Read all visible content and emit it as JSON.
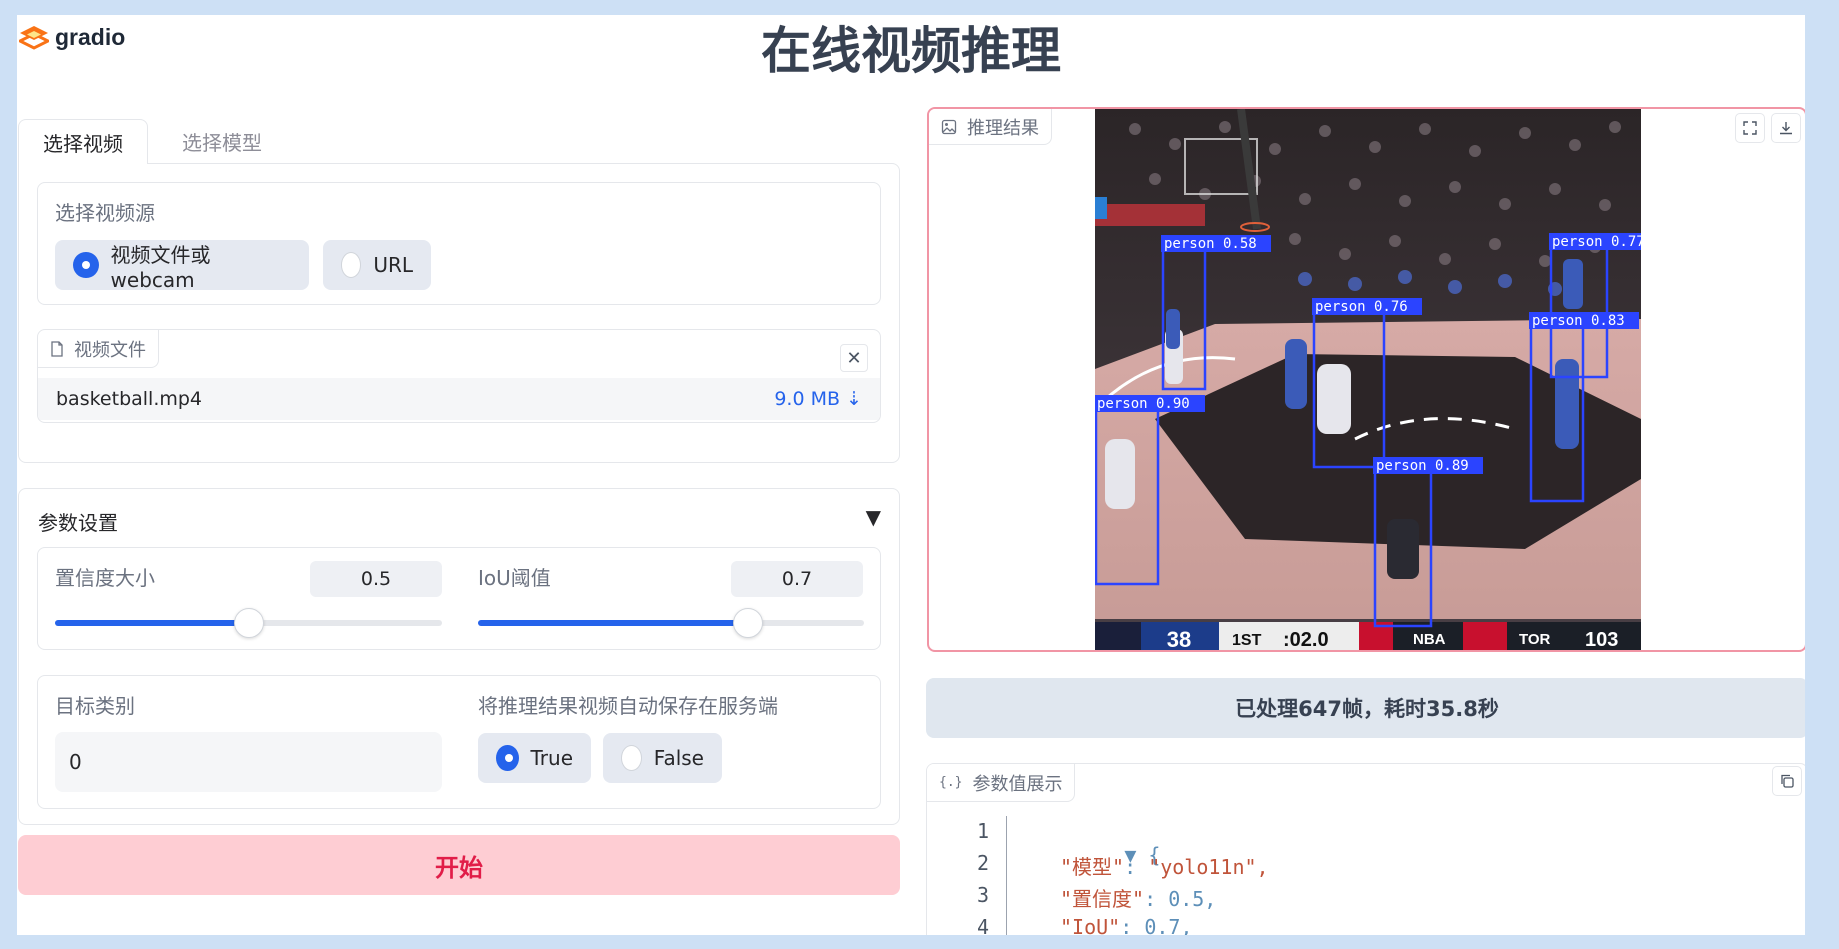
{
  "app": {
    "brand": "gradio",
    "title": "在线视频推理"
  },
  "tabs": [
    {
      "label": "选择视频",
      "active": true
    },
    {
      "label": "选择模型",
      "active": false
    }
  ],
  "video_source": {
    "label": "选择视频源",
    "options": [
      {
        "label": "视频文件或webcam",
        "selected": true
      },
      {
        "label": "URL",
        "selected": false
      }
    ]
  },
  "video_file": {
    "label": "视频文件",
    "file_name": "basketball.mp4",
    "file_size": "9.0 MB ⇣"
  },
  "params": {
    "title": "参数设置",
    "arrow": "▼",
    "confidence": {
      "label": "置信度大小",
      "value": "0.5",
      "fraction": 0.5
    },
    "iou": {
      "label": "IoU阈值",
      "value": "0.7",
      "fraction": 0.7
    },
    "target_class": {
      "label": "目标类别",
      "value": "0"
    },
    "auto_save": {
      "label": "将推理结果视频自动保存在服务端",
      "options": [
        {
          "label": "True",
          "selected": true
        },
        {
          "label": "False",
          "selected": false
        }
      ]
    }
  },
  "start_label": "开始",
  "result": {
    "label": "推理结果",
    "detections": [
      "person 0.58",
      "person 0.77",
      "person 0.76",
      "person 0.83",
      "person 0.90",
      "person 0.89"
    ],
    "scoreboard": {
      "home_score": "38",
      "quarter": "1ST",
      "clock": ":02.0",
      "league": "NBA",
      "away_team": "TOR",
      "away_score": "103"
    }
  },
  "status_text": "已处理647帧，耗时35.8秒",
  "json_view": {
    "label": "参数值展示",
    "lines": [
      {
        "n": "1",
        "brace": "▼ {"
      },
      {
        "n": "2",
        "key": "\"模型\"",
        "value": "\"yolo11n\","
      },
      {
        "n": "3",
        "key": "\"置信度\"",
        "value": "0.5,"
      },
      {
        "n": "4",
        "key": "\"IoU\"",
        "value": "0.7,"
      }
    ]
  },
  "colors": {
    "primary": "#2563eb",
    "accent": "#e11d48",
    "box": "#2b44ff"
  }
}
